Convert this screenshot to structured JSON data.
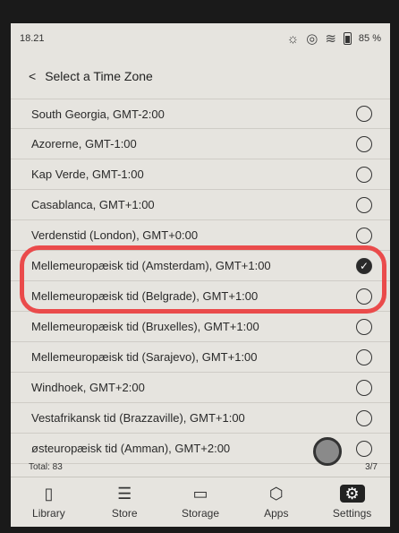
{
  "status": {
    "time": "18.21",
    "battery": "85 %"
  },
  "header": {
    "title": "Select a Time Zone"
  },
  "timezones": [
    {
      "label": "South Georgia, GMT-2:00",
      "selected": false
    },
    {
      "label": "Azorerne, GMT-1:00",
      "selected": false
    },
    {
      "label": "Kap Verde, GMT-1:00",
      "selected": false
    },
    {
      "label": "Casablanca, GMT+1:00",
      "selected": false
    },
    {
      "label": "Verdenstid (London), GMT+0:00",
      "selected": false
    },
    {
      "label": "Mellemeuropæisk tid (Amsterdam), GMT+1:00",
      "selected": true
    },
    {
      "label": "Mellemeuropæisk tid (Belgrade), GMT+1:00",
      "selected": false
    },
    {
      "label": "Mellemeuropæisk tid (Bruxelles), GMT+1:00",
      "selected": false
    },
    {
      "label": "Mellemeuropæisk tid (Sarajevo), GMT+1:00",
      "selected": false
    },
    {
      "label": "Windhoek, GMT+2:00",
      "selected": false
    },
    {
      "label": "Vestafrikansk tid (Brazzaville), GMT+1:00",
      "selected": false
    },
    {
      "label": "østeuropæisk tid (Amman), GMT+2:00",
      "selected": false
    }
  ],
  "footer": {
    "total": "Total: 83",
    "page": "3/7"
  },
  "tabs": [
    {
      "label": "Library",
      "icon": "book-icon"
    },
    {
      "label": "Store",
      "icon": "store-icon"
    },
    {
      "label": "Storage",
      "icon": "folder-icon"
    },
    {
      "label": "Apps",
      "icon": "apps-icon"
    },
    {
      "label": "Settings",
      "icon": "settings-icon",
      "active": true
    }
  ],
  "colors": {
    "highlight": "#ea4b4b",
    "screen": "#e6e4df"
  }
}
